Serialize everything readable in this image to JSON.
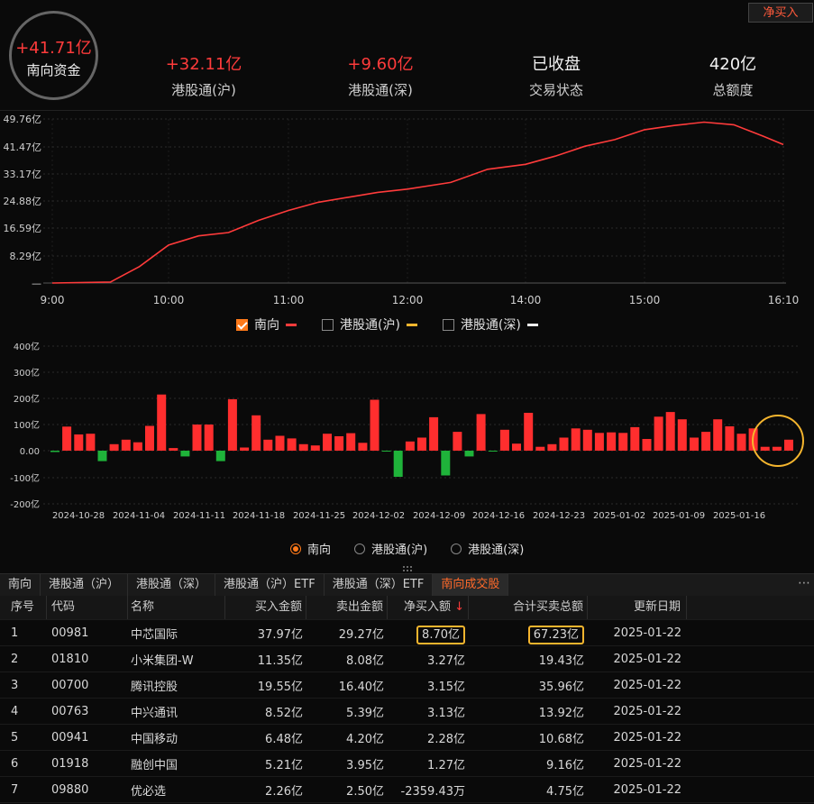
{
  "header": {
    "circle_value": "+41.71亿",
    "circle_label": "南向资金",
    "net_buy_button": "净买入",
    "stats": [
      {
        "value": "+32.11亿",
        "label": "港股通(沪)",
        "color": "#ff3b3b"
      },
      {
        "value": "+9.60亿",
        "label": "港股通(深)",
        "color": "#ff3b3b"
      },
      {
        "value": "已收盘",
        "label": "交易状态",
        "color": "#f2f2f2"
      },
      {
        "value": "420亿",
        "label": "总额度",
        "color": "#f2f2f2"
      }
    ]
  },
  "line_chart": {
    "y_ticks": [
      "49.76亿",
      "41.47亿",
      "33.17亿",
      "24.88亿",
      "16.59亿",
      "8.29亿",
      "—"
    ],
    "x_ticks": [
      "9:00",
      "10:00",
      "11:00",
      "12:00",
      "14:00",
      "15:00",
      "16:10"
    ],
    "legend": [
      {
        "label": "南向",
        "checked": true,
        "color": "#ff3b3b"
      },
      {
        "label": "港股通(沪)",
        "checked": false,
        "color": "#f5b52e"
      },
      {
        "label": "港股通(深)",
        "checked": false,
        "color": "#eeeeee"
      }
    ]
  },
  "chart_data": [
    {
      "type": "line",
      "name": "南向",
      "unit": "亿",
      "ylim": [
        0,
        49.76
      ],
      "x": [
        "9:00",
        "9:30",
        "9:45",
        "10:00",
        "10:15",
        "10:30",
        "10:45",
        "11:00",
        "11:15",
        "11:30",
        "11:45",
        "12:00",
        "13:00",
        "13:30",
        "14:00",
        "14:15",
        "14:30",
        "14:45",
        "15:00",
        "15:15",
        "15:30",
        "15:45",
        "16:00",
        "16:10"
      ],
      "values": [
        0,
        0.3,
        5.0,
        11.5,
        14.3,
        15.3,
        19.0,
        22.0,
        24.5,
        26.0,
        27.5,
        28.5,
        30.5,
        34.5,
        36.0,
        38.5,
        41.5,
        43.5,
        46.5,
        47.8,
        48.8,
        48.0,
        44.5,
        42.0
      ]
    },
    {
      "type": "bar",
      "name": "南向",
      "unit": "亿",
      "y_ticks": [
        "400亿",
        "300亿",
        "200亿",
        "100亿",
        "0.00",
        "-100亿",
        "-200亿"
      ],
      "ylim": [
        -200,
        400
      ],
      "x_tick_labels": [
        "2024-10-28",
        "2024-11-04",
        "2024-11-11",
        "2024-11-18",
        "2024-11-25",
        "2024-12-02",
        "2024-12-09",
        "2024-12-16",
        "2024-12-23",
        "2025-01-02",
        "2025-01-09",
        "2025-01-16"
      ],
      "values": [
        -5,
        92,
        62,
        65,
        -40,
        25,
        42,
        32,
        95,
        215,
        10,
        -22,
        100,
        100,
        -40,
        197,
        12,
        135,
        42,
        57,
        47,
        25,
        20,
        65,
        55,
        67,
        30,
        195,
        -3,
        -100,
        35,
        50,
        128,
        -95,
        72,
        -22,
        140,
        -3,
        80,
        27,
        145,
        15,
        25,
        50,
        85,
        80,
        68,
        70,
        68,
        90,
        45,
        130,
        148,
        120,
        50,
        72,
        120,
        93,
        65,
        85,
        15,
        15,
        42
      ],
      "legend": [
        {
          "label": "南向",
          "selected": true
        },
        {
          "label": "港股通(沪)",
          "selected": false
        },
        {
          "label": "港股通(深)",
          "selected": false
        }
      ]
    }
  ],
  "tabs": [
    {
      "label": "南向",
      "active": false
    },
    {
      "label": "港股通（沪）",
      "active": false
    },
    {
      "label": "港股通（深）",
      "active": false
    },
    {
      "label": "港股通（沪）ETF",
      "active": false
    },
    {
      "label": "港股通（深）ETF",
      "active": false
    },
    {
      "label": "南向成交股",
      "active": true
    }
  ],
  "tab_more": "⋯",
  "table": {
    "headers": [
      "序号",
      "代码",
      "名称",
      "买入金额",
      "卖出金额",
      "净买入额",
      "合计买卖总额",
      "更新日期"
    ],
    "sort_arrow": "↓",
    "rows": [
      [
        "1",
        "00981",
        "中芯国际",
        "37.97亿",
        "29.27亿",
        "8.70亿",
        "67.23亿",
        "2025-01-22"
      ],
      [
        "2",
        "01810",
        "小米集团-W",
        "11.35亿",
        "8.08亿",
        "3.27亿",
        "19.43亿",
        "2025-01-22"
      ],
      [
        "3",
        "00700",
        "腾讯控股",
        "19.55亿",
        "16.40亿",
        "3.15亿",
        "35.96亿",
        "2025-01-22"
      ],
      [
        "4",
        "00763",
        "中兴通讯",
        "8.52亿",
        "5.39亿",
        "3.13亿",
        "13.92亿",
        "2025-01-22"
      ],
      [
        "5",
        "00941",
        "中国移动",
        "6.48亿",
        "4.20亿",
        "2.28亿",
        "10.68亿",
        "2025-01-22"
      ],
      [
        "6",
        "01918",
        "融创中国",
        "5.21亿",
        "3.95亿",
        "1.27亿",
        "9.16亿",
        "2025-01-22"
      ],
      [
        "7",
        "09880",
        "优必选",
        "2.26亿",
        "2.50亿",
        "-2359.43万",
        "4.75亿",
        "2025-01-22"
      ]
    ]
  }
}
